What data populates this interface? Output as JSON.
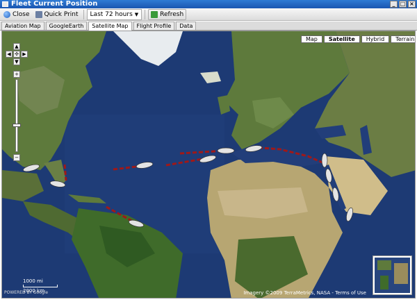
{
  "window": {
    "title": "Fleet Current Position"
  },
  "toolbar": {
    "close_label": "Close",
    "print_label": "Quick Print",
    "period_value": "Last 72 hours",
    "refresh_label": "Refresh"
  },
  "tabs": [
    {
      "label": "Aviation Map"
    },
    {
      "label": "GoogleEarth"
    },
    {
      "label": "Satellite Map",
      "active": true
    },
    {
      "label": "Flight Profile"
    },
    {
      "label": "Data"
    }
  ],
  "map": {
    "type_buttons": [
      {
        "label": "Map"
      },
      {
        "label": "Satellite",
        "active": true
      },
      {
        "label": "Hybrid"
      },
      {
        "label": "Terrain"
      }
    ],
    "scale": {
      "imperial": "1000 mi",
      "metric": "2000 km"
    },
    "powered_by": "POWERED BY Google",
    "attribution": "Imagery ©2009 TerraMetrics, NASA - Terms of Use",
    "colors": {
      "ocean": "#1d3a74",
      "land": "#5e7a3c",
      "desert": "#c8b68a",
      "track": "#a01818",
      "ship": "#e4e4e4"
    }
  }
}
